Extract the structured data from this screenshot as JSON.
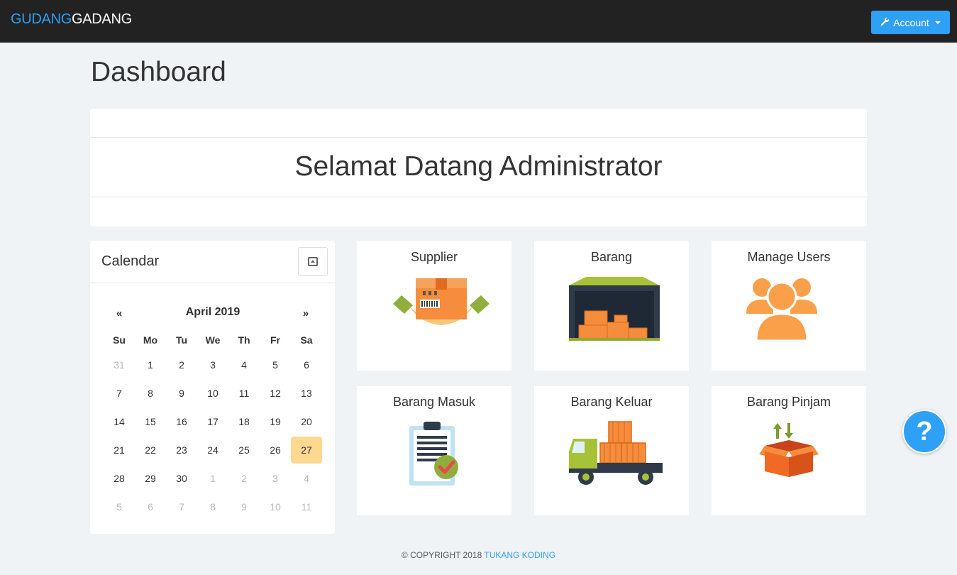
{
  "navbar": {
    "brand_part1": "GUDANG",
    "brand_part2": "GADANG",
    "account_label": "Account"
  },
  "page": {
    "title": "Dashboard"
  },
  "welcome": {
    "message": "Selamat Datang Administrator"
  },
  "calendar": {
    "title": "Calendar",
    "prev": "«",
    "next": "»",
    "month_label": "April 2019",
    "weekdays": [
      "Su",
      "Mo",
      "Tu",
      "We",
      "Th",
      "Fr",
      "Sa"
    ],
    "weeks": [
      [
        {
          "d": "31",
          "m": true
        },
        {
          "d": "1"
        },
        {
          "d": "2"
        },
        {
          "d": "3"
        },
        {
          "d": "4"
        },
        {
          "d": "5"
        },
        {
          "d": "6"
        }
      ],
      [
        {
          "d": "7"
        },
        {
          "d": "8"
        },
        {
          "d": "9"
        },
        {
          "d": "10"
        },
        {
          "d": "11"
        },
        {
          "d": "12"
        },
        {
          "d": "13"
        }
      ],
      [
        {
          "d": "14"
        },
        {
          "d": "15"
        },
        {
          "d": "16"
        },
        {
          "d": "17"
        },
        {
          "d": "18"
        },
        {
          "d": "19"
        },
        {
          "d": "20"
        }
      ],
      [
        {
          "d": "21"
        },
        {
          "d": "22"
        },
        {
          "d": "23"
        },
        {
          "d": "24"
        },
        {
          "d": "25"
        },
        {
          "d": "26"
        },
        {
          "d": "27",
          "t": true
        }
      ],
      [
        {
          "d": "28"
        },
        {
          "d": "29"
        },
        {
          "d": "30"
        },
        {
          "d": "1",
          "m": true
        },
        {
          "d": "2",
          "m": true
        },
        {
          "d": "3",
          "m": true
        },
        {
          "d": "4",
          "m": true
        }
      ],
      [
        {
          "d": "5",
          "m": true
        },
        {
          "d": "6",
          "m": true
        },
        {
          "d": "7",
          "m": true
        },
        {
          "d": "8",
          "m": true
        },
        {
          "d": "9",
          "m": true
        },
        {
          "d": "10",
          "m": true
        },
        {
          "d": "11",
          "m": true
        }
      ]
    ]
  },
  "tiles": [
    {
      "label": "Supplier",
      "icon": "supplier-icon"
    },
    {
      "label": "Barang",
      "icon": "warehouse-icon"
    },
    {
      "label": "Manage Users",
      "icon": "users-icon"
    },
    {
      "label": "Barang Masuk",
      "icon": "clipboard-check-icon"
    },
    {
      "label": "Barang Keluar",
      "icon": "truck-icon"
    },
    {
      "label": "Barang Pinjam",
      "icon": "box-transfer-icon"
    }
  ],
  "help": {
    "label": "?"
  },
  "footer": {
    "prefix": "© COPYRIGHT 2018",
    "link": "TUKANG KODING"
  },
  "colors": {
    "accent": "#2ea0f5",
    "navbar": "#222222",
    "background": "#eff3f6",
    "today": "#fdd891",
    "icon_orange": "#f58d3c"
  }
}
